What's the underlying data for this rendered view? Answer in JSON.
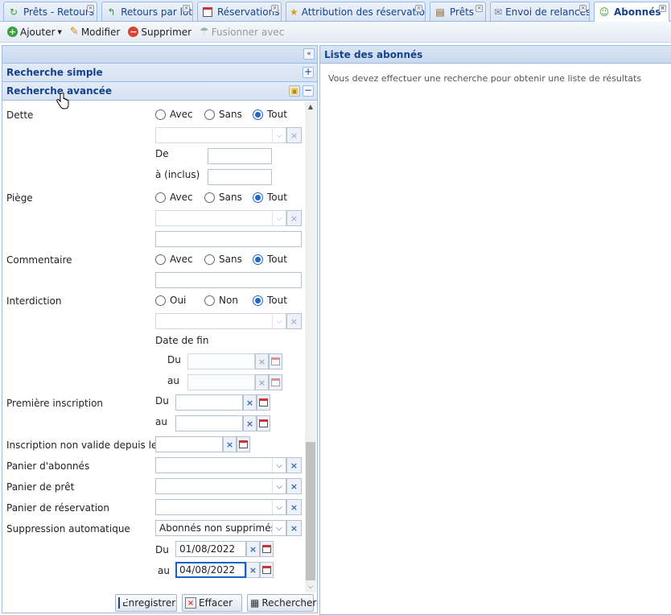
{
  "tabs": [
    {
      "label": "Prêts - Retours",
      "icon": "refresh-arrows-icon",
      "active": false
    },
    {
      "label": "Retours par lot",
      "icon": "return-arrow-icon",
      "active": false
    },
    {
      "label": "Réservations",
      "icon": "calendar-icon",
      "active": false
    },
    {
      "label": "Attribution des réservations",
      "icon": "star-icon",
      "active": false
    },
    {
      "label": "Prêts",
      "icon": "books-icon",
      "active": false
    },
    {
      "label": "Envoi de relances",
      "icon": "envelope-icon",
      "active": false
    },
    {
      "label": "Abonnés",
      "icon": "user-icon",
      "active": true
    }
  ],
  "toolbar": {
    "add_label": "Ajouter",
    "edit_label": "Modifier",
    "delete_label": "Supprimer",
    "merge_label": "Fusionner avec"
  },
  "search_panel": {
    "simple_title": "Recherche simple",
    "advanced_title": "Recherche avancée"
  },
  "form": {
    "dette": {
      "label": "Dette",
      "options": [
        "Avec",
        "Sans",
        "Tout"
      ],
      "selected": "Tout",
      "from_label": "De",
      "to_label": "à (inclus)"
    },
    "piege": {
      "label": "Piège",
      "options": [
        "Avec",
        "Sans",
        "Tout"
      ],
      "selected": "Tout"
    },
    "commentaire": {
      "label": "Commentaire",
      "options": [
        "Avec",
        "Sans",
        "Tout"
      ],
      "selected": "Tout"
    },
    "interdiction": {
      "label": "Interdiction",
      "options": [
        "Oui",
        "Non",
        "Tout"
      ],
      "selected": "Tout",
      "end_date_label": "Date de fin",
      "du_label": "Du",
      "au_label": "au"
    },
    "premiere_inscription": {
      "label": "Première inscription",
      "du_label": "Du",
      "au_label": "au"
    },
    "inscription_non_valide": {
      "label": "Inscription non valide depuis le"
    },
    "panier_abonnes": {
      "label": "Panier d'abonnés"
    },
    "panier_pret": {
      "label": "Panier de prêt"
    },
    "panier_reservation": {
      "label": "Panier de réservation"
    },
    "suppression": {
      "label": "Suppression automatique",
      "value": "Abonnés non supprimés",
      "du_label": "Du",
      "au_label": "au",
      "du_value": "01/08/2022",
      "au_value": "04/08/2022"
    }
  },
  "buttons": {
    "save_label": "Enregistrer",
    "clear_label": "Effacer",
    "search_label": "Rechercher"
  },
  "results": {
    "title": "Liste des abonnés",
    "empty_message": "Vous devez effectuer une recherche pour obtenir une liste de résultats"
  }
}
